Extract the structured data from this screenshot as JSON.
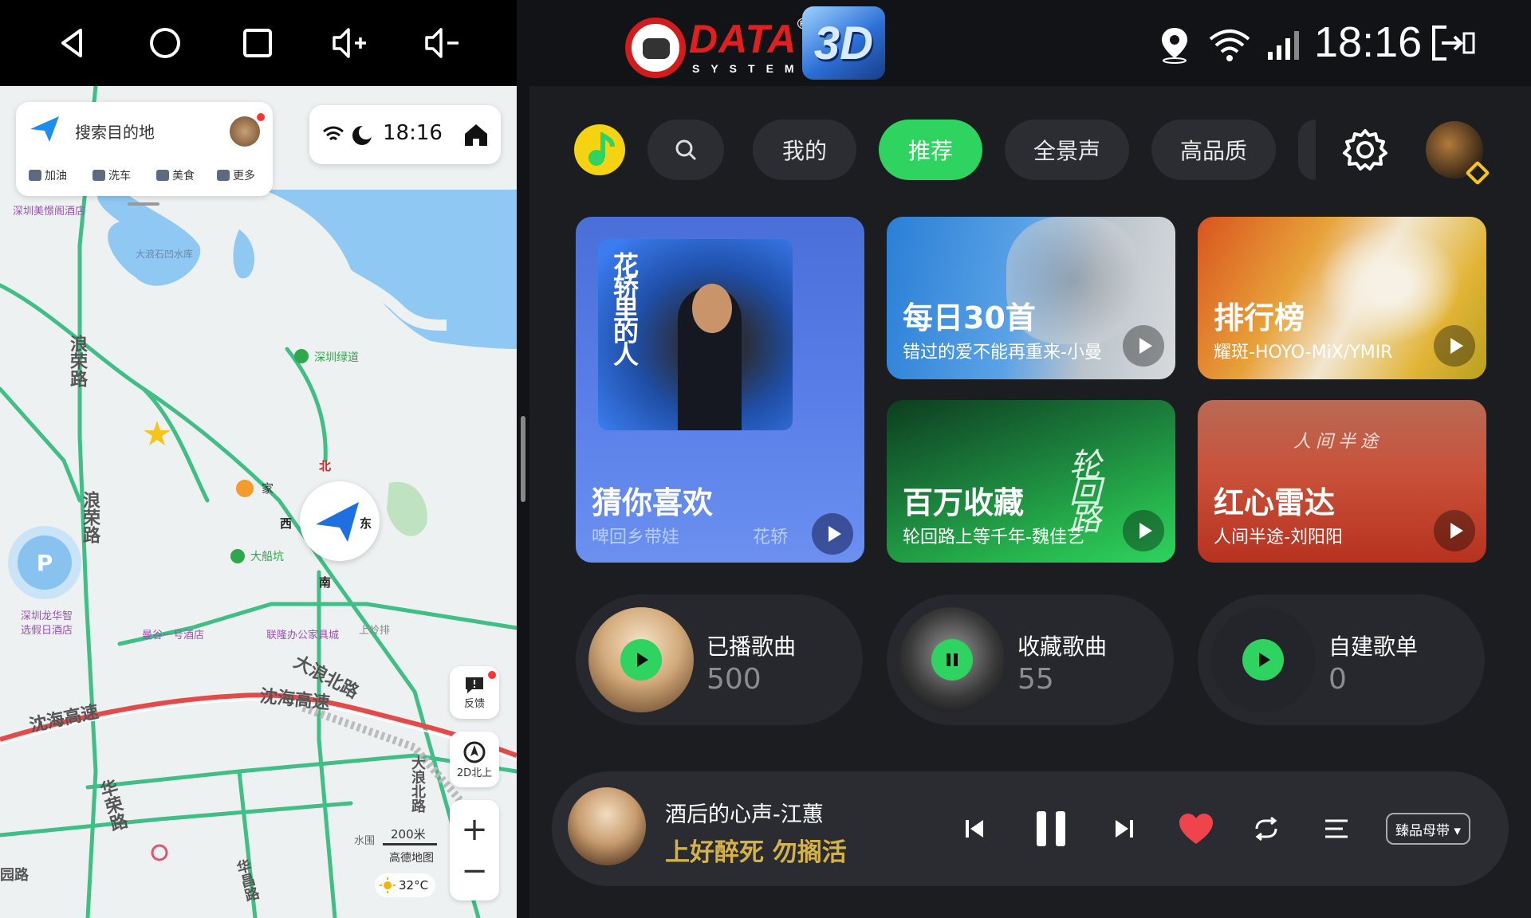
{
  "status_bar": {
    "time": "18:16",
    "logo_text": "DATA",
    "logo_reg": "®",
    "logo_sub": "SYSTEM",
    "logo_3d": "3D",
    "icons": [
      "back-icon",
      "home-icon",
      "recents-icon",
      "volume-up-icon",
      "volume-down-icon",
      "location-icon",
      "wifi-icon",
      "signal-icon",
      "exit-split-icon"
    ]
  },
  "map": {
    "search_placeholder": "搜索目的地",
    "quick_actions": [
      "加油",
      "洗车",
      "美食",
      "更多"
    ],
    "clock": "18:16",
    "compass": {
      "north": "北",
      "south": "南",
      "east": "东",
      "west": "西"
    },
    "feedback": "反馈",
    "view_mode": "2D北上",
    "zoom_in": "+",
    "zoom_out": "−",
    "scale_label": "200米",
    "provider": "高德地图",
    "temperature": "32°C",
    "places": {
      "hotel1": "深圳美憬阁酒店",
      "reservoir": "大浪石凹水库",
      "greenway": "深圳绿道",
      "home": "家",
      "dachuankeng": "大船坑",
      "hotel2a": "深圳龙华智",
      "hotel2b": "选假日酒店",
      "hotel3": "曼谷一号酒店",
      "office": "联隆办公家具城",
      "shanglingpai": "上岭排",
      "dalang_north": "大浪北路",
      "langrong_road1": "浪荣路",
      "langrong_road2": "浪荣路",
      "shenhai1": "沈海高速",
      "shenhai2": "沈海高速",
      "huarong": "华荣路",
      "dalang_n2": "大浪北路",
      "huachang": "华昌路",
      "yuan_road": "园路",
      "shuiwei": "水围"
    }
  },
  "music": {
    "tabs": [
      "我的",
      "推荐",
      "全景声",
      "高品质"
    ],
    "active_tab": "推荐",
    "cards": [
      {
        "title": "猜你喜欢",
        "sub": "啤回乡带娃",
        "sub2": "花轿",
        "cover_text": "花轿里的人"
      },
      {
        "title": "每日30首",
        "sub": "错过的爱不能再重来-小曼"
      },
      {
        "title": "排行榜",
        "sub": "耀斑-HOYO-MiX/YMIR"
      },
      {
        "title": "百万收藏",
        "sub": "轮回路上等千年-魏佳艺",
        "cover_text": "轮回路"
      },
      {
        "title": "红心雷达",
        "sub": "人间半途-刘阳阳",
        "cover_text": "人间半途"
      }
    ],
    "lists": [
      {
        "label": "已播歌曲",
        "count": "500",
        "state": "play"
      },
      {
        "label": "收藏歌曲",
        "count": "55",
        "state": "pause"
      },
      {
        "label": "自建歌单",
        "count": "0",
        "state": "play"
      }
    ],
    "player": {
      "title": "酒后的心声-江蕙",
      "lyric": "上好醉死 勿搁活",
      "quality": "臻品母带 ▾",
      "liked": true
    },
    "colors": {
      "accent": "#2fd35f",
      "background": "#1c1d21",
      "lyric": "#d4b24a"
    }
  }
}
